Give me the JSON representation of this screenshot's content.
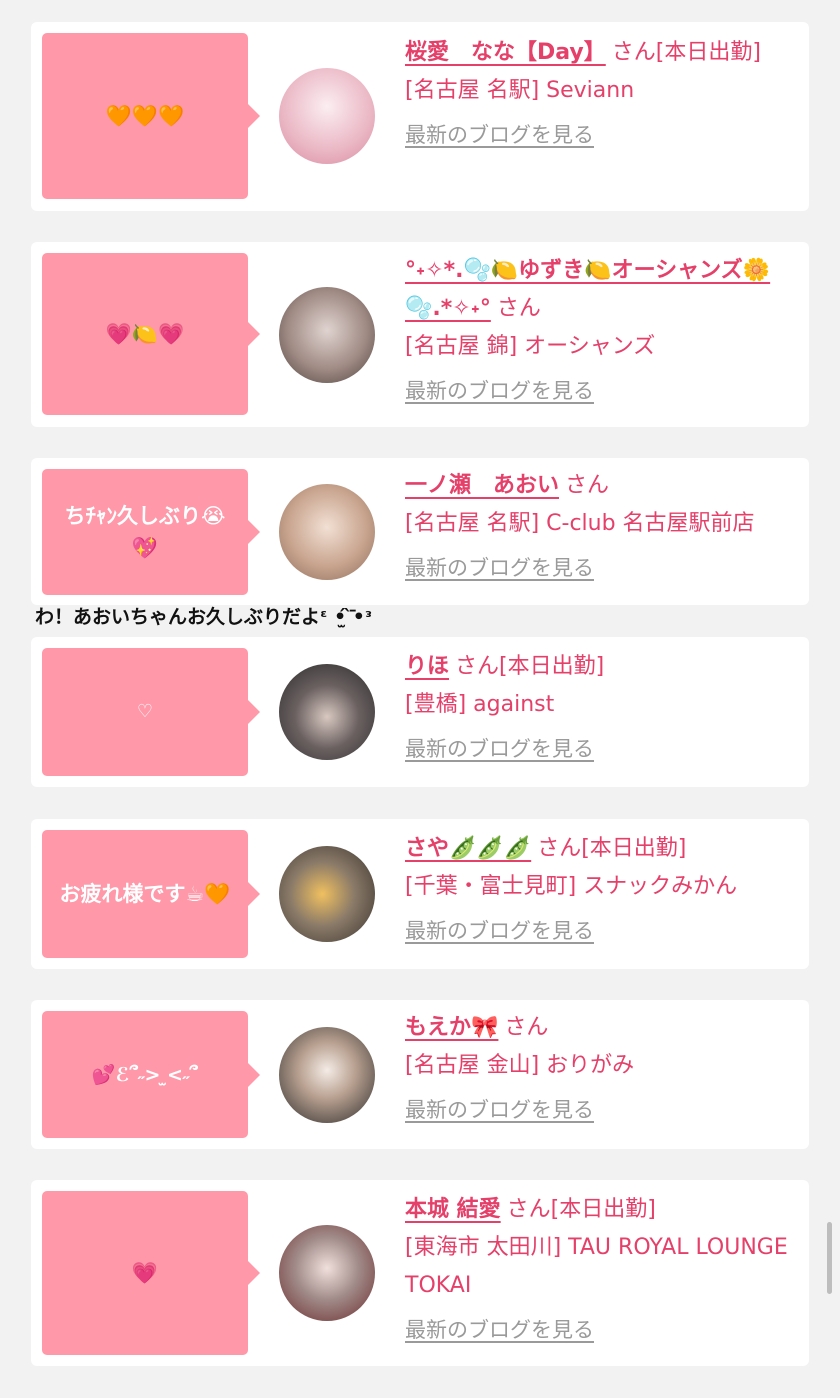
{
  "entries": [
    {
      "bubble": "🧡🧡🧡",
      "name": "桜愛　なな【Day】",
      "honorific": "さん[本日出勤]",
      "shop": "[名古屋 名駅] Seviann",
      "blog_link": "最新のブログを見る",
      "avatar_colors": [
        "#f4e6ea",
        "#d98aa0"
      ]
    },
    {
      "bubble": "💗🍋💗",
      "name": "°˖✧*.🫧🍋ゆずき🍋オーシャンズ🌼🫧.*✧˖°",
      "honorific": "さん",
      "shop": "[名古屋 錦] オーシャンズ",
      "blog_link": "最新のブログを見る",
      "avatar_colors": [
        "#cfc4c0",
        "#4a403c"
      ]
    },
    {
      "bubble": "ちﾁｬﾝ久しぶり😭💖",
      "name": "一ノ瀬　あおい",
      "honorific": "さん",
      "shop": "[名古屋 名駅] C-club 名古屋駅前店",
      "blog_link": "最新のブログを見る",
      "avatar_colors": [
        "#e8d2c4",
        "#8a6a58"
      ]
    },
    {
      "bubble": "♡",
      "name": "りほ",
      "honorific": "さん[本日出勤]",
      "shop": "[豊橋] against",
      "blog_link": "最新のブログを見る",
      "avatar_colors": [
        "#3a3a3a",
        "#e6e6e6"
      ]
    },
    {
      "bubble": "お疲れ様です☕🧡",
      "name": "さや🫛🫛🫛",
      "honorific": "さん[本日出勤]",
      "shop": "[千葉・富士見町] スナックみかん",
      "blog_link": "最新のブログを見る",
      "avatar_colors": [
        "#5a5048",
        "#d8b070"
      ]
    },
    {
      "bubble": "💕ℰ՞˶> ̫<˶՞",
      "name": "もえか🎀",
      "honorific": "さん",
      "shop": "[名古屋 金山] おりがみ",
      "blog_link": "最新のブログを見る",
      "avatar_colors": [
        "#2a2a2a",
        "#d8c6b8"
      ]
    },
    {
      "bubble": "💗",
      "name": "本城 結愛",
      "honorific": "さん[本日出勤]",
      "shop": "[東海市 太田川] TAU ROYAL LOUNGE TOKAI",
      "blog_link": "最新のブログを見る",
      "avatar_colors": [
        "#c8c8c8",
        "#7a3030"
      ]
    }
  ],
  "comment": "わ！あおいちゃんお久しぶりだよᵋ •ֿ̫́ •̀ᵌ",
  "colors": {
    "accent": "#e4406a",
    "bubble": "#ff98a8",
    "link": "#9a9a9a",
    "background": "#f2f2f2"
  }
}
